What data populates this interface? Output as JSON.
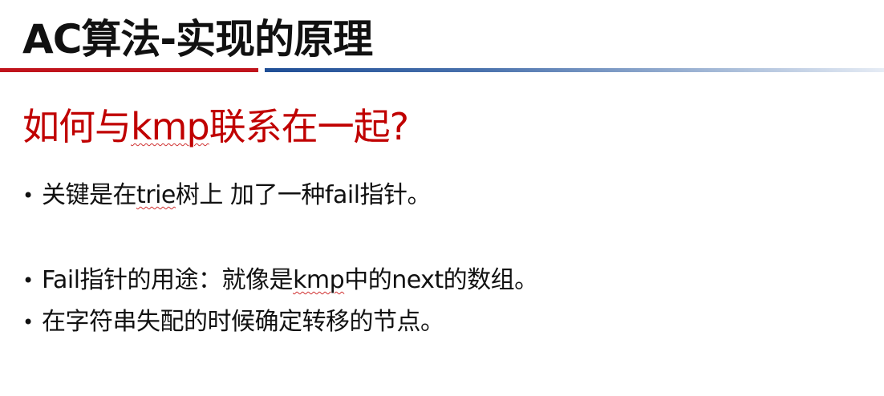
{
  "slide": {
    "title": "AC算法-实现的原理",
    "subtitle_pre": "如何与",
    "subtitle_kmp": "kmp",
    "subtitle_post": "联系在一起?",
    "bullets": [
      {
        "pre": "关键是在",
        "mark": "trie",
        "post": "树上 加了一种fail指针。"
      },
      {
        "pre": "Fail指针的用途：就像是",
        "mark": "kmp",
        "post": "中的next的数组。"
      },
      {
        "pre": "在字符串失配的时候确定转移的节点。",
        "mark": "",
        "post": ""
      }
    ],
    "bullet_glyph": "•"
  },
  "colors": {
    "title": "#111111",
    "subtitle": "#c00000",
    "rule_red": "#c0141c",
    "rule_blue": "#1f4e96"
  }
}
